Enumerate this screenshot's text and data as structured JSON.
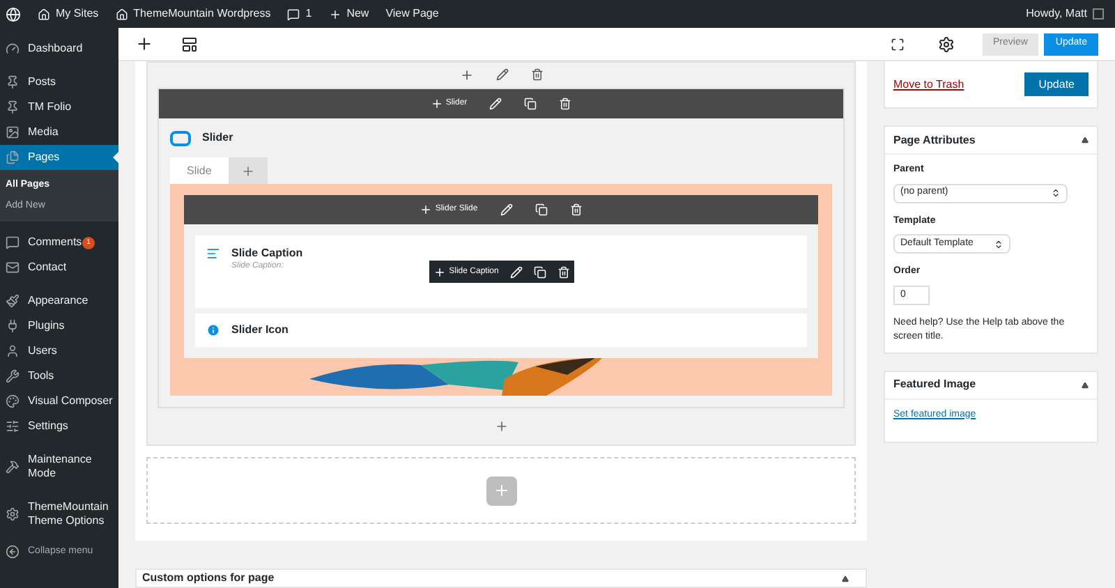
{
  "admin_bar": {
    "my_sites": "My Sites",
    "site": "ThemeMountain Wordpress",
    "comments": "1",
    "new": "New",
    "view_page": "View Page",
    "greeting": "Howdy, Matt"
  },
  "sidebar": {
    "items": [
      {
        "label": "Dashboard",
        "selected": false
      },
      {
        "label": "Posts",
        "selected": false
      },
      {
        "label": "TM Folio",
        "selected": false
      },
      {
        "label": "Media",
        "selected": false
      },
      {
        "label": "Pages",
        "selected": true,
        "children": [
          {
            "label": "All Pages",
            "selected": true
          },
          {
            "label": "Add New",
            "selected": false
          }
        ]
      },
      {
        "label": "Comments",
        "selected": false,
        "badge": "1"
      },
      {
        "label": "Contact",
        "selected": false
      },
      {
        "label": "Appearance",
        "selected": false
      },
      {
        "label": "Plugins",
        "selected": false
      },
      {
        "label": "Users",
        "selected": false
      },
      {
        "label": "Tools",
        "selected": false
      },
      {
        "label": "Visual Composer",
        "selected": false
      },
      {
        "label": "Settings",
        "selected": false
      },
      {
        "label": "Maintenance Mode",
        "selected": false
      },
      {
        "label": "ThemeMountain Theme Options",
        "selected": false
      }
    ],
    "collapse": "Collapse menu"
  },
  "toolbar": {
    "preview": "Preview",
    "update": "Update"
  },
  "builder": {
    "slider_bar_label": "Slider",
    "element_title": "Slider",
    "tabs": [
      {
        "label": "Slide",
        "selected": true
      }
    ],
    "slide_bar_label": "Slider Slide",
    "elements": [
      {
        "title": "Slide Caption",
        "subtitle": "Slide Caption:",
        "kind": "caption"
      },
      {
        "title": "Slider Icon",
        "kind": "icon"
      }
    ],
    "hover_bar_label": "Slide Caption"
  },
  "custom_options": {
    "title": "Custom options for page"
  },
  "publish": {
    "trash": "Move to Trash",
    "update": "Update"
  },
  "page_attributes": {
    "title": "Page Attributes",
    "parent_label": "Parent",
    "parent": "(no parent)",
    "template_label": "Template",
    "template": "Default Template",
    "order_label": "Order",
    "order": "0",
    "help": "Need help? Use the Help tab above the screen title."
  },
  "featured_image": {
    "title": "Featured Image",
    "link": "Set featured image"
  }
}
